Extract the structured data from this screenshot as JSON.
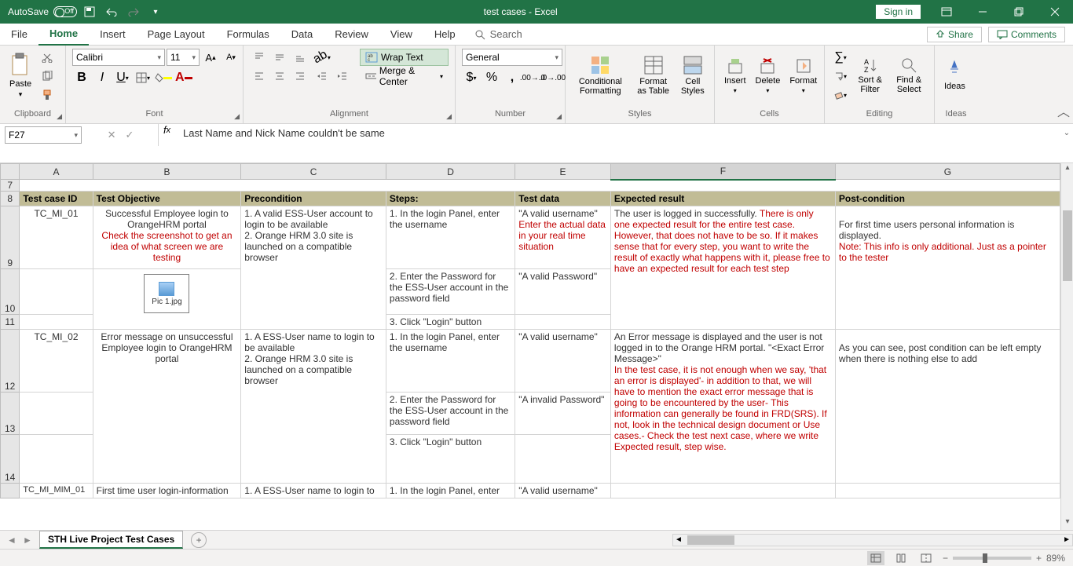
{
  "title": "test cases  -  Excel",
  "autosave": "AutoSave",
  "autosave_state": "Off",
  "signin": "Sign in",
  "tabs": {
    "file": "File",
    "home": "Home",
    "insert": "Insert",
    "page": "Page Layout",
    "formulas": "Formulas",
    "data": "Data",
    "review": "Review",
    "view": "View",
    "help": "Help",
    "search": "Search"
  },
  "share": "Share",
  "comments": "Comments",
  "ribbon": {
    "clipboard": "Clipboard",
    "paste": "Paste",
    "font": "Font",
    "fontname": "Calibri",
    "fontsize": "11",
    "alignment": "Alignment",
    "wrap": "Wrap Text",
    "merge": "Merge & Center",
    "number": "Number",
    "numfmt": "General",
    "styles": "Styles",
    "cond": "Conditional Formatting",
    "fat": "Format as Table",
    "cellst": "Cell Styles",
    "cells": "Cells",
    "insert": "Insert",
    "delete": "Delete",
    "format": "Format",
    "editing": "Editing",
    "sort": "Sort & Filter",
    "find": "Find & Select",
    "ideas": "Ideas"
  },
  "namebox": "F27",
  "formula": "Last Name and Nick Name couldn't be same",
  "cols": [
    "A",
    "B",
    "C",
    "D",
    "E",
    "F",
    "G"
  ],
  "headers": {
    "a": "Test case ID",
    "b": "Test Objective",
    "c": "Precondition",
    "d": "Steps:",
    "e": "Test data",
    "f": "Expected result",
    "g": "Post-condition"
  },
  "r9": {
    "a": "TC_MI_01",
    "b1": "Successful Employee login to OrangeHRM portal",
    "b2": "Check the screenshot to get an idea of what screen we are testing",
    "c": "1. A valid ESS-User account to login to be available\n2. Orange HRM 3.0 site is launched on a compatible browser",
    "d": "1. In the login Panel, enter the username",
    "e1": "\"A valid username\"",
    "e2": "Enter the actual data in your real time situation",
    "f1": "The user is logged in successfully. ",
    "f2": "There is only one expected result for the entire test case. However, that does not have to be so. If it makes sense that for every step, you want to write the result of exactly what happens with it, please free to have an expected result for each test step",
    "g1": "For first time users personal information is displayed.",
    "g2": "Note: This info is only additional. Just as a pointer to the tester"
  },
  "r10": {
    "pic": "Pic 1.jpg",
    "d": "2. Enter the Password for the ESS-User account in the password field",
    "e": "\"A valid Password\""
  },
  "r11": {
    "d": "3. Click \"Login\" button"
  },
  "r12": {
    "a": "TC_MI_02",
    "b": "Error message on unsuccessful Employee login to OrangeHRM portal",
    "c": "1. A ESS-User name to login to be available\n2. Orange HRM 3.0 site is launched on a compatible browser",
    "d": "1. In the login Panel, enter the username",
    "e": "\"A valid username\"",
    "f1": "An Error message is displayed and the user is not logged in to the Orange HRM portal. \"<Exact Error Message>\"",
    "f2": "In the test case, it is not  enough when we say, 'that an error is displayed'- in addition to that, we will have to mention the exact error message that is going to be encountered by the user- This information can generally be found in FRD(SRS). If not, look in the technical design document or Use cases.- Check the test next case, where we write Expected result, step wise.",
    "g": "As you can see, post condition can be left empty when there is nothing else to add"
  },
  "r13": {
    "d": "2. Enter the Password for the ESS-User account in the password field",
    "e": "\"A invalid Password\""
  },
  "r14": {
    "d": "3. Click \"Login\" button"
  },
  "r15": {
    "a": "TC_MI_MIM_01",
    "b": "First time user login-information",
    "c": "1. A ESS-User name to login to",
    "d": "1. In the login Panel, enter",
    "e": "\"A valid username\""
  },
  "sheetname": "STH Live Project Test Cases",
  "zoom": "89%"
}
